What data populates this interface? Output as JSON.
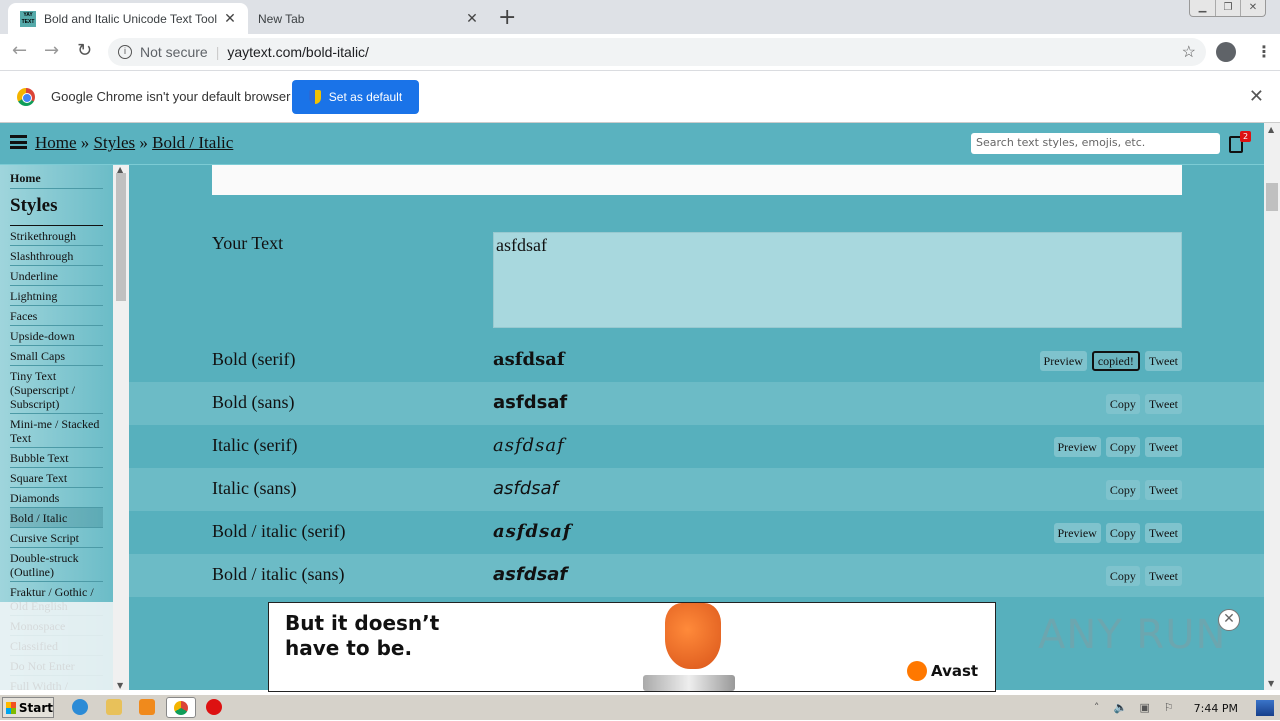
{
  "browser": {
    "tabs": [
      {
        "title": "Bold and Italic Unicode Text Tool - B",
        "favicon": "YAY TEXT",
        "active": true
      },
      {
        "title": "New Tab",
        "active": false
      }
    ],
    "address": {
      "security": "Not secure",
      "url": "yaytext.com/bold-italic/"
    },
    "infobar": {
      "message": "Google Chrome isn't your default browser",
      "button": "Set as default"
    }
  },
  "site": {
    "breadcrumb": [
      "Home",
      "Styles",
      "Bold / Italic"
    ],
    "breadcrumb_sep": "»",
    "search_placeholder": "Search text styles, emojis, etc.",
    "clipboard_count": "2",
    "sidebar": {
      "home": "Home",
      "heading": "Styles",
      "items": [
        "Strikethrough",
        "Slashthrough",
        "Underline",
        "Lightning",
        "Faces",
        "Upside-down",
        "Small Caps",
        "Tiny Text (Superscript / Subscript)",
        "Mini-me / Stacked Text",
        "Bubble Text",
        "Square Text",
        "Diamonds",
        "Bold / Italic",
        "Cursive Script",
        "Double-struck (Outline)",
        "Fraktur / Gothic / Old English",
        "Monospace",
        "Classified",
        "Do Not Enter",
        "Full Width / Vaporwave"
      ],
      "active": "Bold / Italic"
    },
    "input": {
      "label": "Your Text",
      "value": "asfdsaf"
    },
    "rows": [
      {
        "label": "Bold (serif)",
        "output": "asfdsaf",
        "buttons": [
          "Preview",
          "copied!",
          "Tweet"
        ]
      },
      {
        "label": "Bold (sans)",
        "output": "asfdsaf",
        "buttons": [
          "Copy",
          "Tweet"
        ]
      },
      {
        "label": "Italic (serif)",
        "output": "asfdsaf",
        "buttons": [
          "Preview",
          "Copy",
          "Tweet"
        ]
      },
      {
        "label": "Italic (sans)",
        "output": "asfdsaf",
        "buttons": [
          "Copy",
          "Tweet"
        ]
      },
      {
        "label": "Bold / italic (serif)",
        "output": "asfdsaf",
        "buttons": [
          "Preview",
          "Copy",
          "Tweet"
        ]
      },
      {
        "label": "Bold / italic (sans)",
        "output": "asfdsaf",
        "buttons": [
          "Copy",
          "Tweet"
        ]
      }
    ]
  },
  "ad": {
    "headline_1": "But it doesn’t",
    "headline_2": "have to be.",
    "brand": "Avast",
    "close": "✕"
  },
  "watermark": "ANY RUN",
  "taskbar": {
    "start": "Start",
    "clock": "7:44 PM"
  }
}
